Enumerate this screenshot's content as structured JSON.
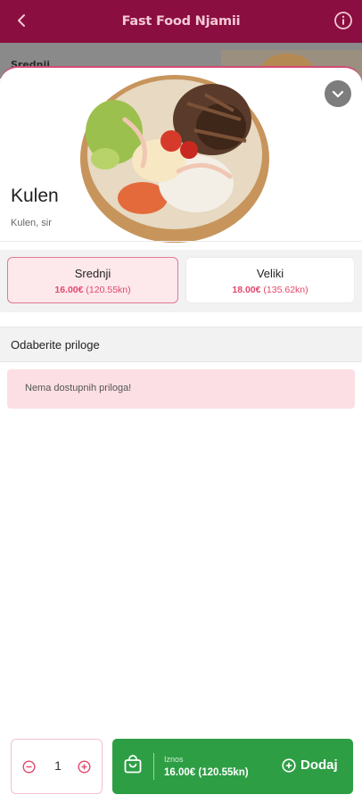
{
  "header": {
    "title": "Fast Food Njamii",
    "back_icon": "chevron-left-icon",
    "info_icon": "info-icon"
  },
  "background": {
    "peek_text": "Srednji"
  },
  "item": {
    "name": "Kulen",
    "description": "Kulen, sir"
  },
  "sizes": [
    {
      "name": "Srednji",
      "price": "16.00€",
      "price_kn": "(120.55kn)",
      "selected": true
    },
    {
      "name": "Veliki",
      "price": "18.00€",
      "price_kn": "(135.62kn)",
      "selected": false
    }
  ],
  "addons": {
    "heading": "Odaberite priloge",
    "empty_message": "Nema dostupnih priloga!"
  },
  "cart": {
    "quantity": "1",
    "amount_label": "Iznos",
    "amount": "16.00€ (120.55kn)",
    "add_label": "Dodaj"
  },
  "colors": {
    "header_bg": "#8a0e3f",
    "accent_pink": "#e2476c",
    "selected_bg": "#fde8ec",
    "add_green": "#2e9e45",
    "note_bg": "#fbdfe4"
  }
}
